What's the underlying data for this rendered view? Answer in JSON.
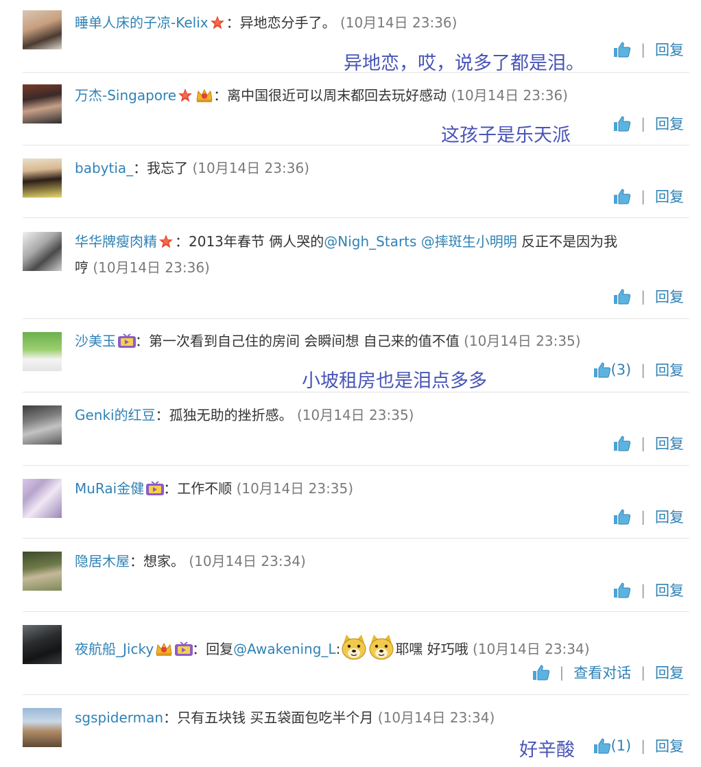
{
  "comments": [
    {
      "name": "睡单人床的子凉-Kelix",
      "text": "：异地恋分手了。",
      "time": "(10月14日 23:36)",
      "annotation": "异地恋，哎，说多了都是泪。",
      "reply": "回复"
    },
    {
      "name": "万杰-Singapore",
      "text": "：离中国很近可以周末都回去玩好感动",
      "time": "(10月14日 23:36)",
      "annotation": "这孩子是乐天派",
      "reply": "回复"
    },
    {
      "name": "babytia_",
      "text": "：我忘了",
      "time": "(10月14日 23:36)",
      "reply": "回复"
    },
    {
      "name": "华华牌瘦肉精",
      "text": "：2013年春节 俩人哭的",
      "mention1": "@Nigh_Starts",
      "mention2": "@摔斑生小明明",
      "text2": " 反正不是因为我",
      "text3": "哼",
      "time": "(10月14日 23:36)",
      "reply": "回复"
    },
    {
      "name": "沙美玉",
      "text": "：第一次看到自己住的房间 会瞬间想 自己来的值不值",
      "time": "(10月14日 23:35)",
      "annotation": "小坡租房也是泪点多多",
      "like_count": "(3)",
      "reply": "回复"
    },
    {
      "name": "Genki的红豆",
      "text": "：孤独无助的挫折感。",
      "time": "(10月14日 23:35)",
      "reply": "回复"
    },
    {
      "name": "MuRai金健",
      "text": "：工作不顺",
      "time": "(10月14日 23:35)",
      "reply": "回复"
    },
    {
      "name": "隐居木屋",
      "text": "：想家。",
      "time": "(10月14日 23:34)",
      "reply": "回复"
    },
    {
      "name": "夜航船_Jicky",
      "text": "：回复",
      "mention1": "@Awakening_L",
      "text2": ":",
      "text3": "耶嘿 好巧哦",
      "time": "(10月14日 23:34)",
      "view_dialog": "查看对话",
      "reply": "回复"
    },
    {
      "name": "sgspiderman",
      "text": "：只有五块钱 买五袋面包吃半个月",
      "time": "(10月14日 23:34)",
      "annotation": "好辛酸",
      "like_count": "(1)",
      "reply": "回复"
    }
  ],
  "colors": {
    "link": "#2f82b5",
    "annotation": "#4854b8",
    "time": "#7a7a7a",
    "divider": "#e3e3e3"
  },
  "icons": {
    "like": "thumbs-up-icon",
    "star_badge": "star-badge-icon",
    "crown_badge": "crown-badge-icon",
    "tv_badge": "tv-badge-icon",
    "emoji": "doge-emoji-icon"
  }
}
